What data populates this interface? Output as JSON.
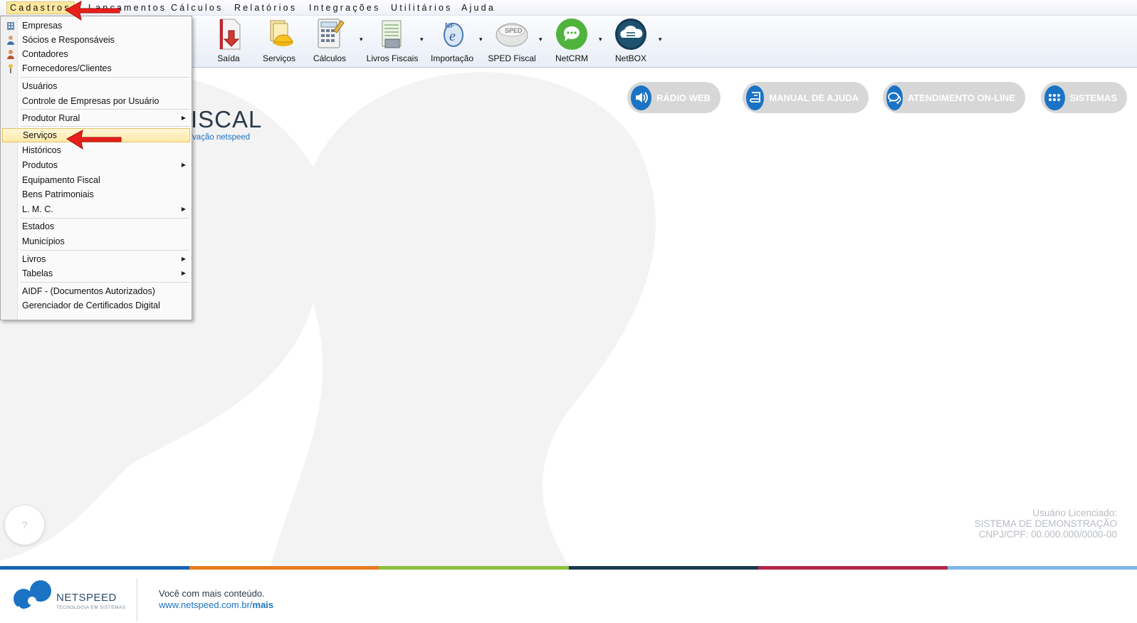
{
  "menubar": {
    "items": [
      "Cadastros",
      "Lançamentos",
      "Cálculos",
      "Relatórios",
      "Integrações",
      "Utilitários",
      "Ajuda"
    ]
  },
  "toolbar": {
    "buttons": [
      "Saída",
      "Serviços",
      "Cálculos",
      "Livros Fiscais",
      "Importação",
      "SPED Fiscal",
      "NetCRM",
      "NetBOX"
    ],
    "dropdown_glyph": "▾"
  },
  "dropdown": {
    "items": [
      "Empresas",
      "Sócios e Responsáveis",
      "Contadores",
      "Fornecedores/Clientes",
      "Usuários",
      "Controle de Empresas por Usuário",
      "Produtor Rural",
      "Serviços",
      "Históricos",
      "Produtos",
      "Equipamento Fiscal",
      "Bens Patrimoniais",
      "L. M. C.",
      "Estados",
      "Municípios",
      "Livros",
      "Tabelas",
      "AIDF - (Documentos Autorizados)",
      "Gerenciador de Certificados Digital"
    ],
    "highlighted": "Serviços",
    "submenu_glyph": "▶"
  },
  "quick_links": {
    "radio": "RÁDIO WEB",
    "manual": "MANUAL DE AJUDA",
    "atendimento": "ATENDIMENTO ON-LINE",
    "sistemas": "SISTEMAS"
  },
  "logo": {
    "fiscal": "ISCAL",
    "sub": "vação netspeed"
  },
  "license": {
    "line1": "Usuário Licenciado:",
    "line2": "SISTEMA DE DEMONSTRAÇÃO",
    "line3": "CNPJ/CPF: 00.000.000/0000-00"
  },
  "help": {
    "glyph": "?"
  },
  "footer": {
    "brand": "NETSPEED",
    "tagline": "TECNOLOGIA EM SISTEMAS",
    "line1": "Você com mais conteúdo.",
    "url_prefix": "www.netspeed.com.br/",
    "url_bold": "mais"
  },
  "colors": {
    "accent_blue": "#1a73c4",
    "strip": [
      "#1565b5",
      "#e87a1e",
      "#8cbf3f",
      "#1c3a50",
      "#b3264a",
      "#7db6e8"
    ],
    "highlight": "#fde9a6"
  }
}
